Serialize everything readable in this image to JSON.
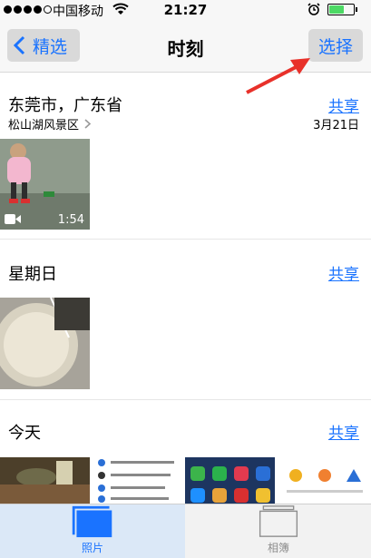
{
  "status_bar": {
    "carrier": "中国移动",
    "time": "21:27"
  },
  "nav": {
    "back_label": "精选",
    "title": "时刻",
    "select_label": "选择"
  },
  "moments": [
    {
      "title": "东莞市，广东省",
      "subtitle": "松山湖风景区",
      "share": "共享",
      "date": "3月21日",
      "video_duration": "1:54"
    },
    {
      "title": "星期日",
      "share": "共享"
    },
    {
      "title": "今天",
      "share": "共享"
    }
  ],
  "tabbar": {
    "photos_label": "照片",
    "albums_label": "相簿"
  },
  "colors": {
    "accent": "#1a73ff",
    "annotation_arrow": "#e8312a",
    "battery": "#4cd964"
  }
}
